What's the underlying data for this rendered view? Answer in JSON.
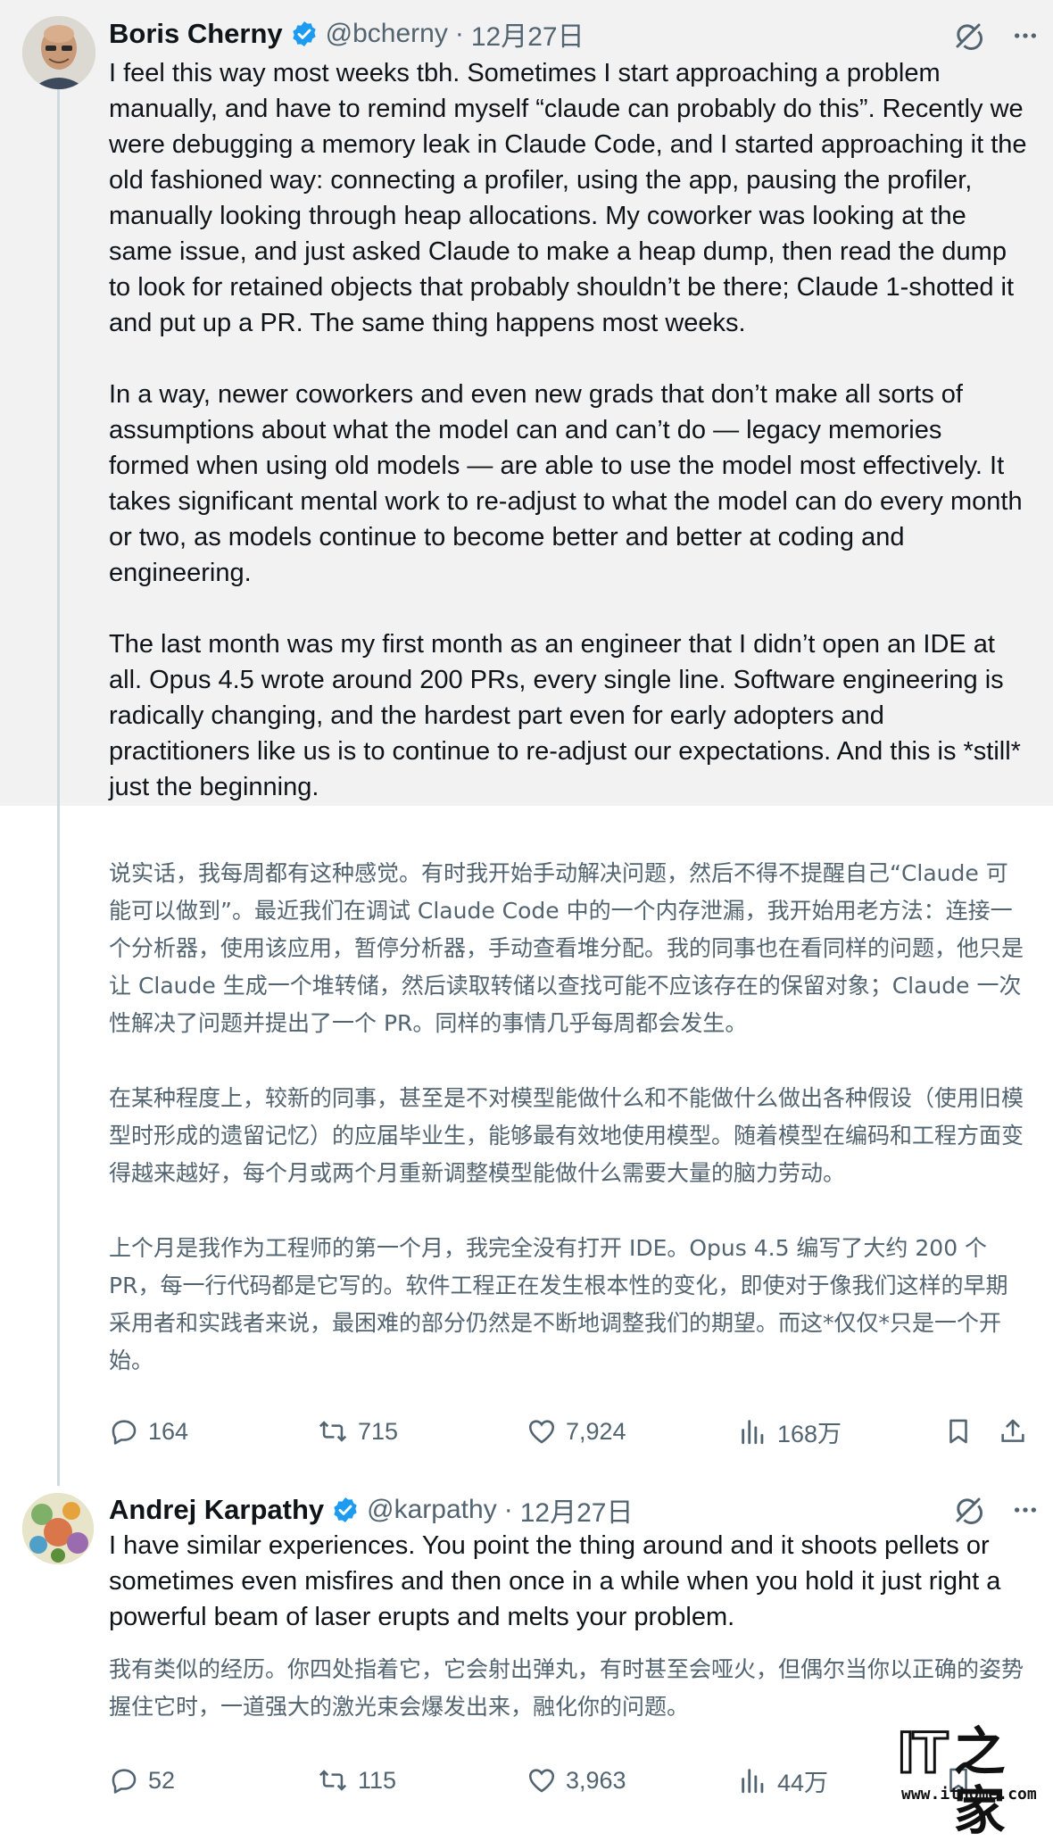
{
  "tweets": [
    {
      "author": {
        "name": "Boris Cherny",
        "handle": "@bcherny",
        "verified": true,
        "avatar_icon": "avatar-photo-bald-man"
      },
      "separator": "·",
      "date": "12月27日",
      "text_en": [
        "I feel this way most weeks tbh. Sometimes I start approaching a problem manually, and have to remind myself “claude can probably do this”. Recently we were debugging a memory leak in Claude Code, and I started approaching it the old fashioned way: connecting a profiler, using the app, pausing the profiler, manually looking through heap allocations. My coworker was looking at the same issue, and just asked Claude to make a heap dump, then read the dump to look for retained objects that probably shouldn’t be there; Claude 1-shotted it and put up a PR. The same thing happens most weeks.",
        "In a way, newer coworkers and even new grads that don’t make all sorts of assumptions about what the model can and can’t do — legacy memories formed when using old models — are able to use the model most effectively. It takes significant mental work to re-adjust to what the model can do every month or two, as models continue to become better and better at coding and engineering.",
        "The last month was my first month as an engineer that I didn’t open an IDE at all. Opus 4.5 wrote around 200 PRs, every single line. Software engineering is radically changing, and the hardest part even for early adopters and practitioners like us is to continue to re-adjust our expectations. And this is *still* just the beginning."
      ],
      "text_zh": [
        "说实话，我每周都有这种感觉。有时我开始手动解决问题，然后不得不提醒自己“Claude 可能可以做到”。最近我们在调试 Claude Code 中的一个内存泄漏，我开始用老方法：连接一个分析器，使用该应用，暂停分析器，手动查看堆分配。我的同事也在看同样的问题，他只是让 Claude 生成一个堆转储，然后读取转储以查找可能不应该存在的保留对象；Claude 一次性解决了问题并提出了一个 PR。同样的事情几乎每周都会发生。",
        "在某种程度上，较新的同事，甚至是不对模型能做什么和不能做什么做出各种假设（使用旧模型时形成的遗留记忆）的应届毕业生，能够最有效地使用模型。随着模型在编码和工程方面变得越来越好，每个月或两个月重新调整模型能做什么需要大量的脑力劳动。",
        "上个月是我作为工程师的第一个月，我完全没有打开 IDE。Opus 4.5 编写了大约 200 个 PR，每一行代码都是它写的。软件工程正在发生根本性的变化，即使对于像我们这样的早期采用者和实践者来说，最困难的部分仍然是不断地调整我们的期望。而这*仅仅*只是一个开始。"
      ],
      "stats": {
        "replies": "164",
        "retweets": "715",
        "likes": "7,924",
        "views": "168万"
      }
    },
    {
      "author": {
        "name": "Andrej Karpathy",
        "handle": "@karpathy",
        "verified": true,
        "avatar_icon": "avatar-illustration-colorful"
      },
      "separator": "·",
      "date": "12月27日",
      "text_en": [
        "I have similar experiences. You point the thing around and it shoots pellets or sometimes even misfires and then once in a while when you hold it just right a powerful beam of laser erupts and melts your problem."
      ],
      "text_zh": [
        "我有类似的经历。你四处指着它，它会射出弹丸，有时甚至会哑火，但偶尔当你以正确的姿势握住它时，一道强大的激光束会爆发出来，融化你的问题。"
      ],
      "stats": {
        "replies": "52",
        "retweets": "115",
        "likes": "3,963",
        "views": "44万"
      }
    }
  ],
  "icons": {
    "verified": "verified-badge-icon",
    "grok": "grok-icon",
    "more": "more-icon",
    "reply": "reply-icon",
    "retweet": "retweet-icon",
    "like": "like-icon",
    "views": "views-icon",
    "bookmark": "bookmark-icon",
    "share": "share-icon"
  },
  "colors": {
    "verified_blue": "#1d9bf0",
    "text_primary": "#0f1419",
    "text_secondary": "#536471",
    "thread_line": "#cfd9de",
    "highlight_bg": "#f2f2f2"
  },
  "watermark": {
    "logo_latin": "IT",
    "logo_han": "之家",
    "url": "www.ithome.com"
  }
}
